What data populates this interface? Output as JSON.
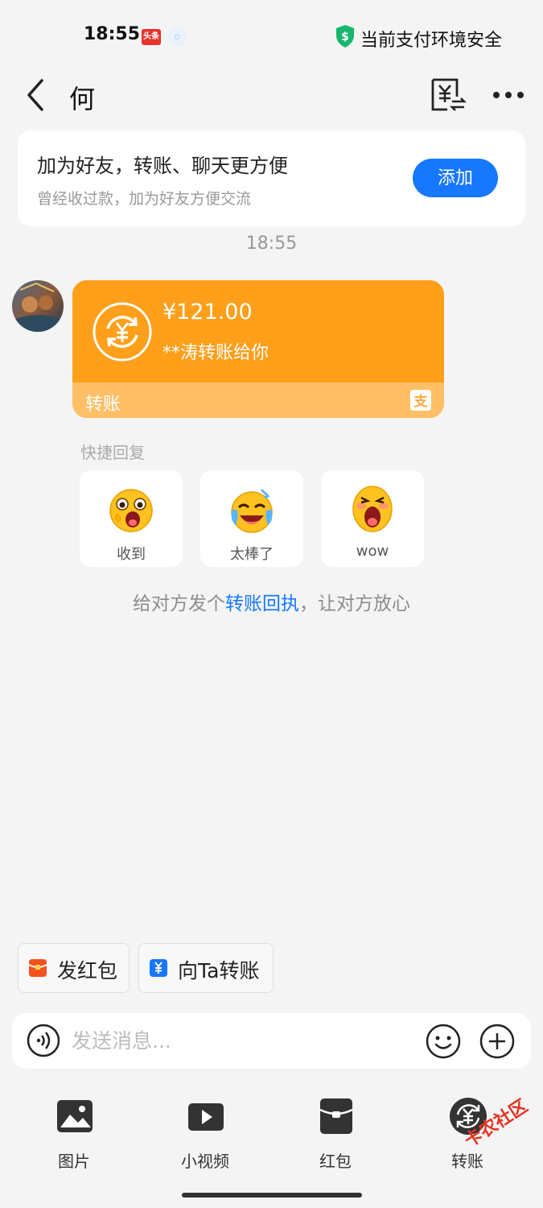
{
  "status_bar": {
    "time": "18:55",
    "app_badge_1": "头条",
    "app_badge_2": "",
    "security_text": "当前支付环境安全"
  },
  "header": {
    "contact_name": "何"
  },
  "friend_card": {
    "title": "加为好友，转账、聊天更方便",
    "subtitle": "曾经收过款，加为好友方便交流",
    "add_label": "添加"
  },
  "chat_time": "18:55",
  "transfer": {
    "amount": "¥121.00",
    "from": "**涛转账给你",
    "label": "转账",
    "color_main": "#ff9f1a",
    "color_footer": "#ffbf66"
  },
  "quick_reply": {
    "title": "快捷回复",
    "items": [
      {
        "label": "收到",
        "icon": "shocked-emoji-icon"
      },
      {
        "label": "太棒了",
        "icon": "crying-laughing-emoji-icon"
      },
      {
        "label": "wow",
        "icon": "wow-emoji-icon"
      }
    ]
  },
  "receipt_hint": {
    "prefix": "给对方发个",
    "link": "转账回执",
    "suffix": "，让对方放心"
  },
  "chips": [
    {
      "label": "发红包",
      "icon": "red-packet-icon",
      "color": "#f4511e"
    },
    {
      "label": "向Ta转账",
      "icon": "yuan-transfer-icon",
      "color": "#1677ff"
    }
  ],
  "input": {
    "placeholder": "发送消息..."
  },
  "tools": [
    {
      "label": "图片",
      "icon": "image-icon"
    },
    {
      "label": "小视频",
      "icon": "video-icon"
    },
    {
      "label": "红包",
      "icon": "red-packet-icon"
    },
    {
      "label": "转账",
      "icon": "transfer-icon"
    }
  ],
  "watermark": "卡农社区"
}
